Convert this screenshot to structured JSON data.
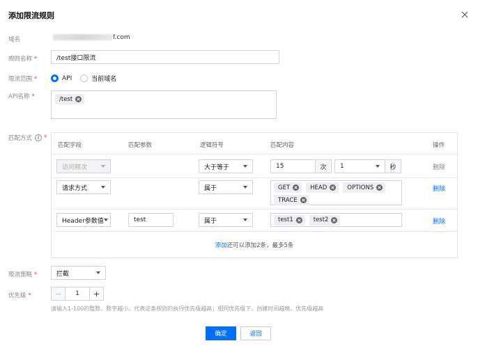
{
  "dialog": {
    "title": "添加限流规则"
  },
  "fields": {
    "domain": {
      "label": "域名",
      "value_suffix": "f.com"
    },
    "rule_name": {
      "label": "规则名称",
      "value": "/test接口限流"
    },
    "scope": {
      "label": "限流范围",
      "options": [
        "API",
        "当前域名"
      ],
      "selected": "API"
    },
    "api_name": {
      "label": "API名称",
      "tags": [
        "/test"
      ]
    },
    "match_mode": {
      "label": "匹配方式"
    },
    "strategy": {
      "label": "限流策略",
      "value": "拦截"
    },
    "priority": {
      "label": "优先级",
      "value": "1",
      "minus": "−",
      "plus": "+",
      "hint": "请输入1-100的整数，数字越小，代表这条规则的执行优先级越高；相同优先级下，创建时间越晚，优先级越高"
    }
  },
  "required_mark": "*",
  "info_glyph": "i",
  "table": {
    "headers": {
      "field": "匹配字段",
      "param": "匹配参数",
      "operator": "逻辑符号",
      "content": "匹配内容",
      "action": "操作"
    },
    "rows": [
      {
        "field": "访问频次",
        "param": "",
        "operator": "大于等于",
        "count": "15",
        "count_unit": "次",
        "period": "1",
        "period_unit": "秒",
        "action": "删除"
      },
      {
        "field": "请求方式",
        "param": "",
        "operator": "属于",
        "tags": [
          "GET",
          "HEAD",
          "OPTIONS",
          "TRACE"
        ],
        "action": "删除"
      },
      {
        "field": "Header参数值",
        "param": "test",
        "operator": "属于",
        "tags": [
          "test1",
          "test2"
        ],
        "action": "删除"
      }
    ],
    "footer": {
      "add_link": "添加",
      "remaining": "还可以添加2条，最多5条"
    }
  },
  "buttons": {
    "confirm": "确定",
    "back": "返回"
  },
  "colors": {
    "primary": "#006eff",
    "required": "#e54545"
  }
}
